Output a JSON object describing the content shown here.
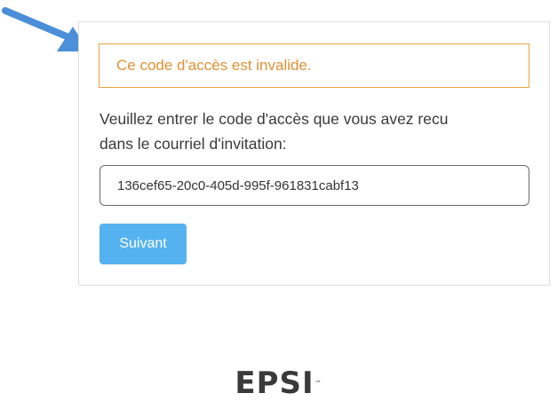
{
  "error": {
    "message": "Ce code d'accès est invalide.",
    "color": "#e09035",
    "border_color": "#e8a33f"
  },
  "form": {
    "instructions_line1": "Veuillez entrer le code d'accès que vous avez recu",
    "instructions_line2": "dans le courriel d'invitation:",
    "access_code_value": "136cef65-20c0-405d-995f-961831cabf13",
    "next_button_label": "Suivant",
    "button_color": "#55b2f1"
  },
  "annotation": {
    "icon": "pointer-arrow-icon",
    "color": "#4a8fd8"
  },
  "branding": {
    "logo_text": "EPSI",
    "trademark": "™"
  }
}
